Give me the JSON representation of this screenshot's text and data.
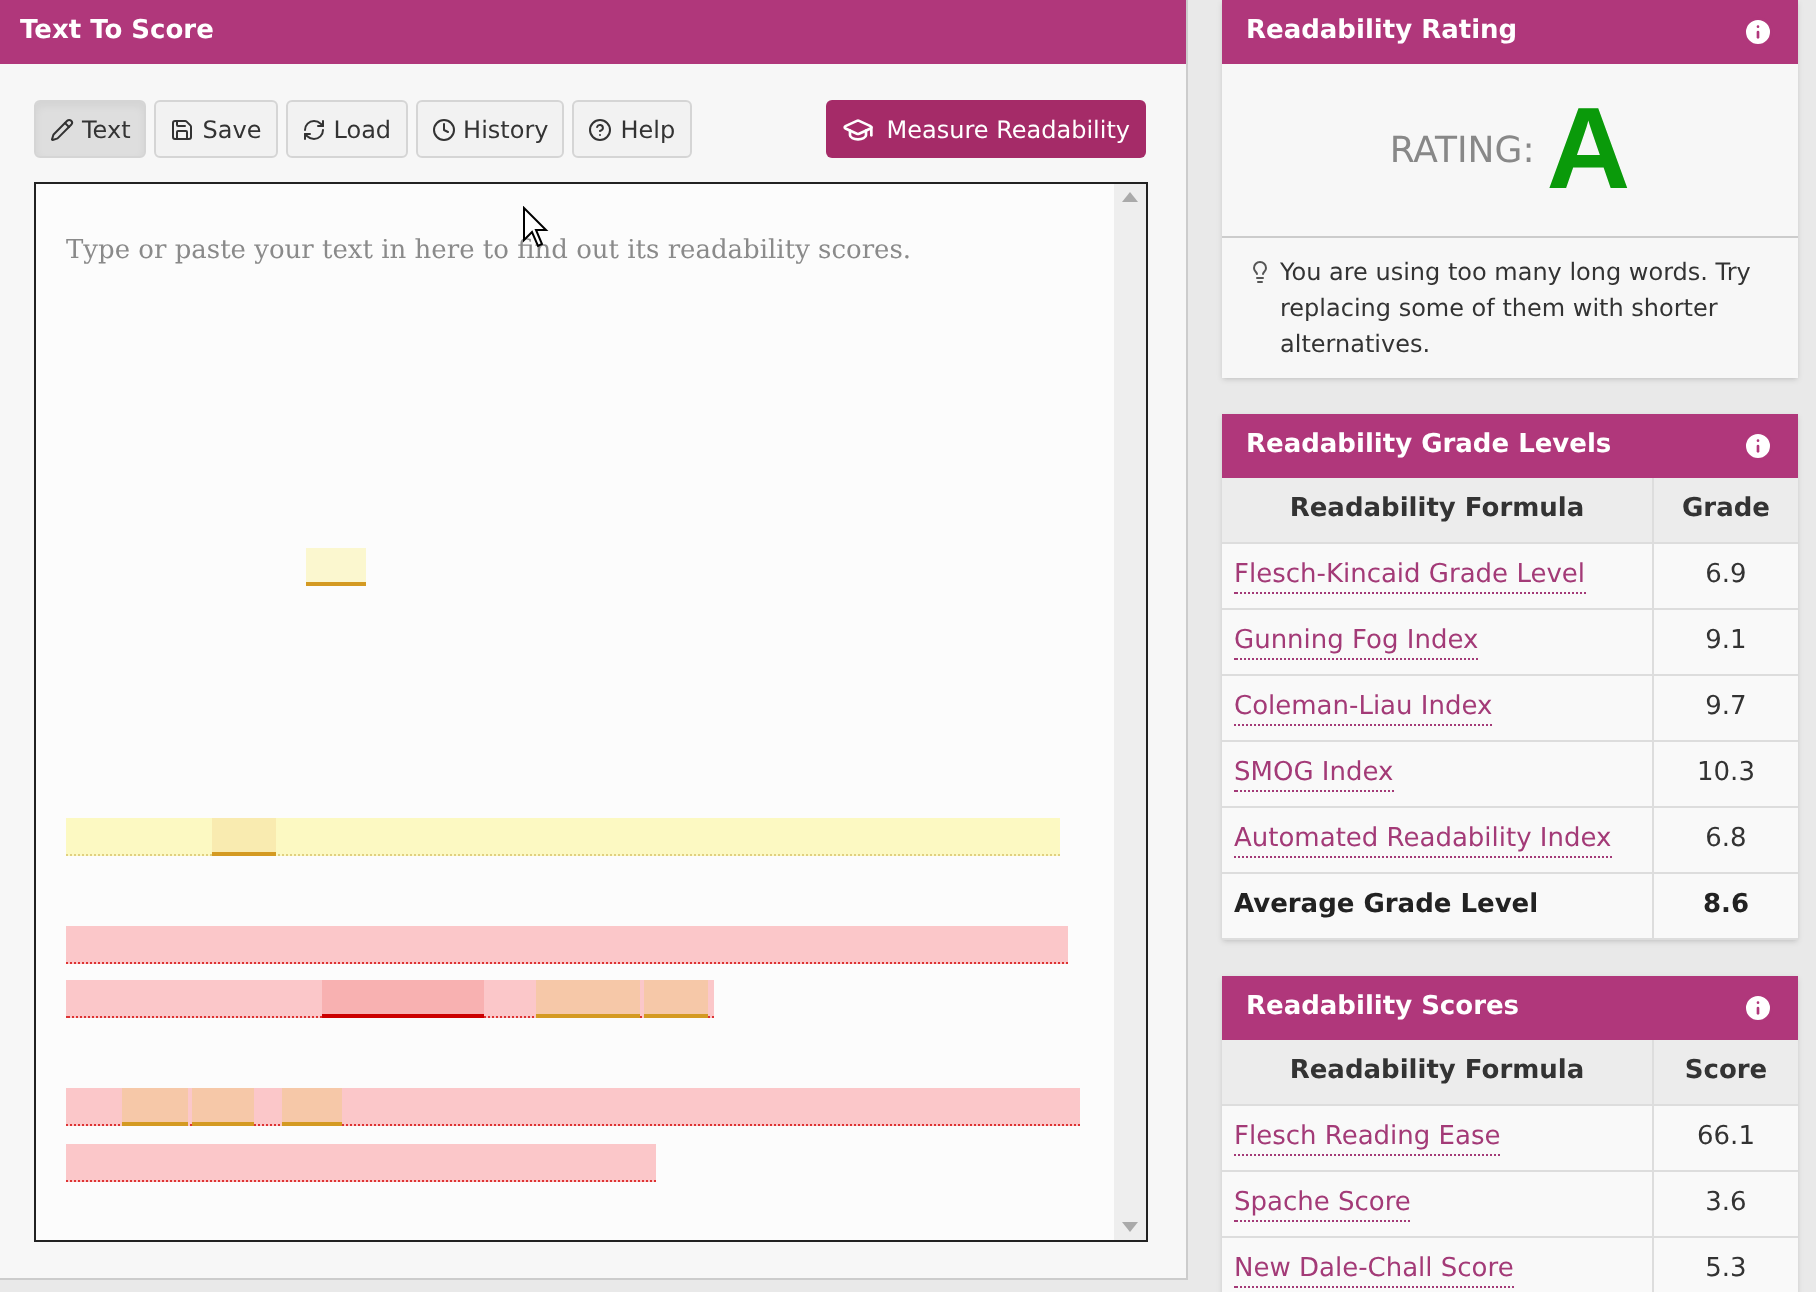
{
  "editor_panel": {
    "title": "Text To Score",
    "toolbar": [
      {
        "label": "Text",
        "kind": "pencil",
        "selected": true
      },
      {
        "label": "Save",
        "kind": "save",
        "selected": false
      },
      {
        "label": "Load",
        "kind": "refresh",
        "selected": false
      },
      {
        "label": "History",
        "kind": "clock",
        "selected": false
      },
      {
        "label": "Help",
        "kind": "help",
        "selected": false
      }
    ],
    "measure_button": "Measure Readability",
    "text_area": {
      "placeholder": "Type or paste your text in here to find out its readability scores."
    }
  },
  "rating_card": {
    "title": "Readability Rating",
    "label": "RATING:",
    "grade": "A",
    "tip": "You are using too many long words. Try replacing some of them with shorter alternatives."
  },
  "grade_levels": {
    "title": "Readability Grade Levels",
    "columns": [
      "Readability Formula",
      "Grade"
    ],
    "rows": [
      {
        "formula": "Flesch-Kincaid Grade Level",
        "value": "6.9",
        "kind": "link"
      },
      {
        "formula": "Gunning Fog Index",
        "value": "9.1",
        "kind": "link"
      },
      {
        "formula": "Coleman-Liau Index",
        "value": "9.7",
        "kind": "link"
      },
      {
        "formula": "SMOG Index",
        "value": "10.3",
        "kind": "link"
      },
      {
        "formula": "Automated Readability Index",
        "value": "6.8",
        "kind": "link"
      },
      {
        "formula": "Average Grade Level",
        "value": "8.6",
        "kind": "total"
      }
    ]
  },
  "scores": {
    "title": "Readability Scores",
    "columns": [
      "Readability Formula",
      "Score"
    ],
    "rows": [
      {
        "formula": "Flesch Reading Ease",
        "value": "66.1",
        "kind": "link"
      },
      {
        "formula": "Spache Score",
        "value": "3.6",
        "kind": "link"
      },
      {
        "formula": "New Dale-Chall Score",
        "value": "5.3",
        "kind": "link"
      }
    ]
  }
}
